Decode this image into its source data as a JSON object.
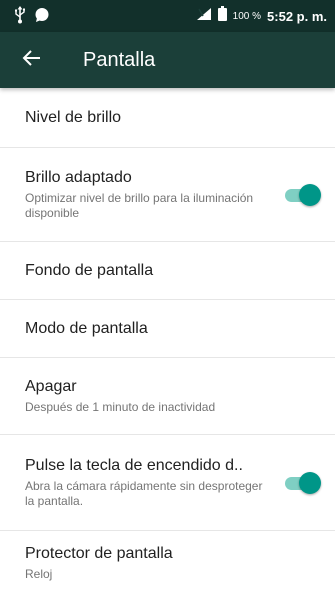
{
  "status_bar": {
    "battery_percent": "100 %",
    "time": "5:52 p. m.",
    "icons": [
      "usb-icon",
      "message-bubble-icon",
      "signal-icon",
      "battery-icon"
    ]
  },
  "app_bar": {
    "title": "Pantalla",
    "back_icon": "arrow-back-icon"
  },
  "settings": [
    {
      "title": "Nivel de brillo",
      "summary": ""
    },
    {
      "title": "Brillo adaptado",
      "summary": "Optimizar nivel de brillo para la iluminación disponible",
      "toggle": "on"
    },
    {
      "title": "Fondo de pantalla",
      "summary": ""
    },
    {
      "title": "Modo de pantalla",
      "summary": ""
    },
    {
      "title": "Apagar",
      "summary": "Después de 1 minuto de inactividad"
    },
    {
      "title": "Pulse la tecla de encendido d..",
      "summary": "Abra la cámara rápidamente sin desproteger la pantalla.",
      "toggle": "on"
    },
    {
      "title": "Protector de pantalla",
      "summary": "Reloj"
    }
  ],
  "colors": {
    "status_bar": "#12302b",
    "app_bar": "#1b3f39",
    "accent": "#009688",
    "toggle_track": "#7fcfc3"
  }
}
